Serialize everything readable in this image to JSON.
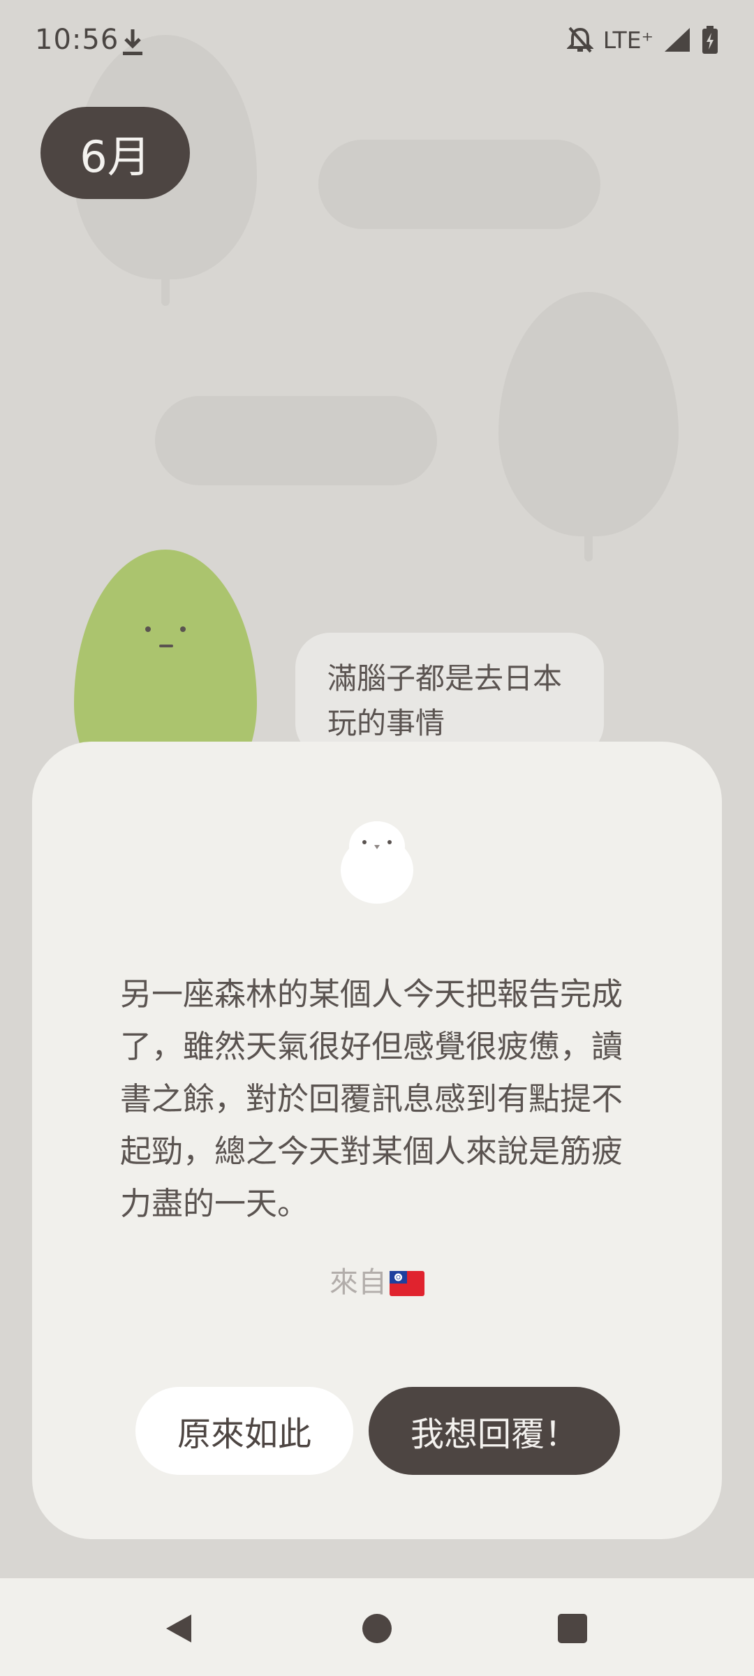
{
  "status_bar": {
    "time": "10:56",
    "network": "LTE⁺",
    "icons": [
      "download-icon",
      "bell-off-icon",
      "signal-icon",
      "battery-charging-icon"
    ]
  },
  "month": "6月",
  "speech_bubble": {
    "text": "滿腦子都是去日本玩的事情"
  },
  "dialog": {
    "message": "另一座森林的某個人今天把報告完成了，雖然天氣很好但感覺很疲憊，讀書之餘，對於回覆訊息感到有點提不起勁，總之今天對某個人來說是筋疲力盡的一天。",
    "from_label": "來自",
    "from_flag": "flag-taiwan-icon",
    "ok_button": "原來如此",
    "reply_button": "我想回覆！"
  },
  "colors": {
    "background": "#d8d6d2",
    "dark_accent": "#4d4542",
    "green_character": "#abc46e",
    "dialog_bg": "#f1f0ec"
  },
  "nav_bar": {
    "icons": [
      "back-icon",
      "home-icon",
      "recents-icon"
    ]
  }
}
